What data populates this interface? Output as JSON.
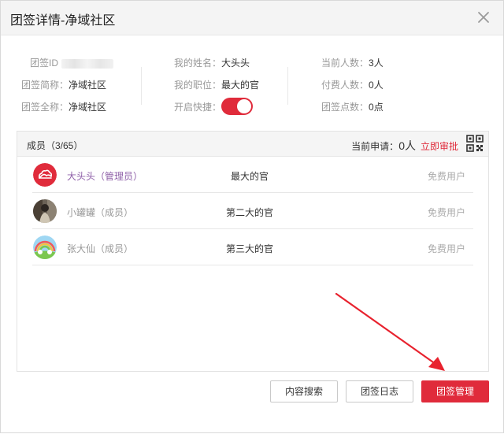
{
  "dialog": {
    "title": "团签详情-净域社区"
  },
  "info": {
    "col1": {
      "id_label": "团签ID",
      "short_name_label": "团签简称：",
      "short_name_value": "净域社区",
      "full_name_label": "团签全称：",
      "full_name_value": "净域社区"
    },
    "col2": {
      "my_name_label": "我的姓名：",
      "my_name_value": "大头头",
      "my_position_label": "我的职位：",
      "my_position_value": "最大的官",
      "quick_label": "开启快捷：",
      "quick_on": true
    },
    "col3": {
      "current_count_label": "当前人数：",
      "current_count_value": "3人",
      "paid_count_label": "付费人数：",
      "paid_count_value": "0人",
      "points_label": "团签点数：",
      "points_value": "0点"
    }
  },
  "members": {
    "title": "成员（3/65）",
    "pending_label": "当前申请：",
    "pending_count": "0人",
    "approve_link": "立即审批",
    "rows": [
      {
        "name": "大头头（管理员）",
        "role": "最大的官",
        "type": "免费用户",
        "avatar": "cloud-logo"
      },
      {
        "name": "小罐罐（成员）",
        "role": "第二大的官",
        "type": "免费用户",
        "avatar": "photo"
      },
      {
        "name": "张大仙（成员）",
        "role": "第三大的官",
        "type": "免费用户",
        "avatar": "rainbow"
      }
    ]
  },
  "buttons": {
    "search": "内容搜索",
    "log": "团签日志",
    "manage": "团签管理"
  },
  "colors": {
    "accent": "#e02b3b",
    "admin_name": "#8e5fa8",
    "annotation_arrow": "#e8222e"
  }
}
